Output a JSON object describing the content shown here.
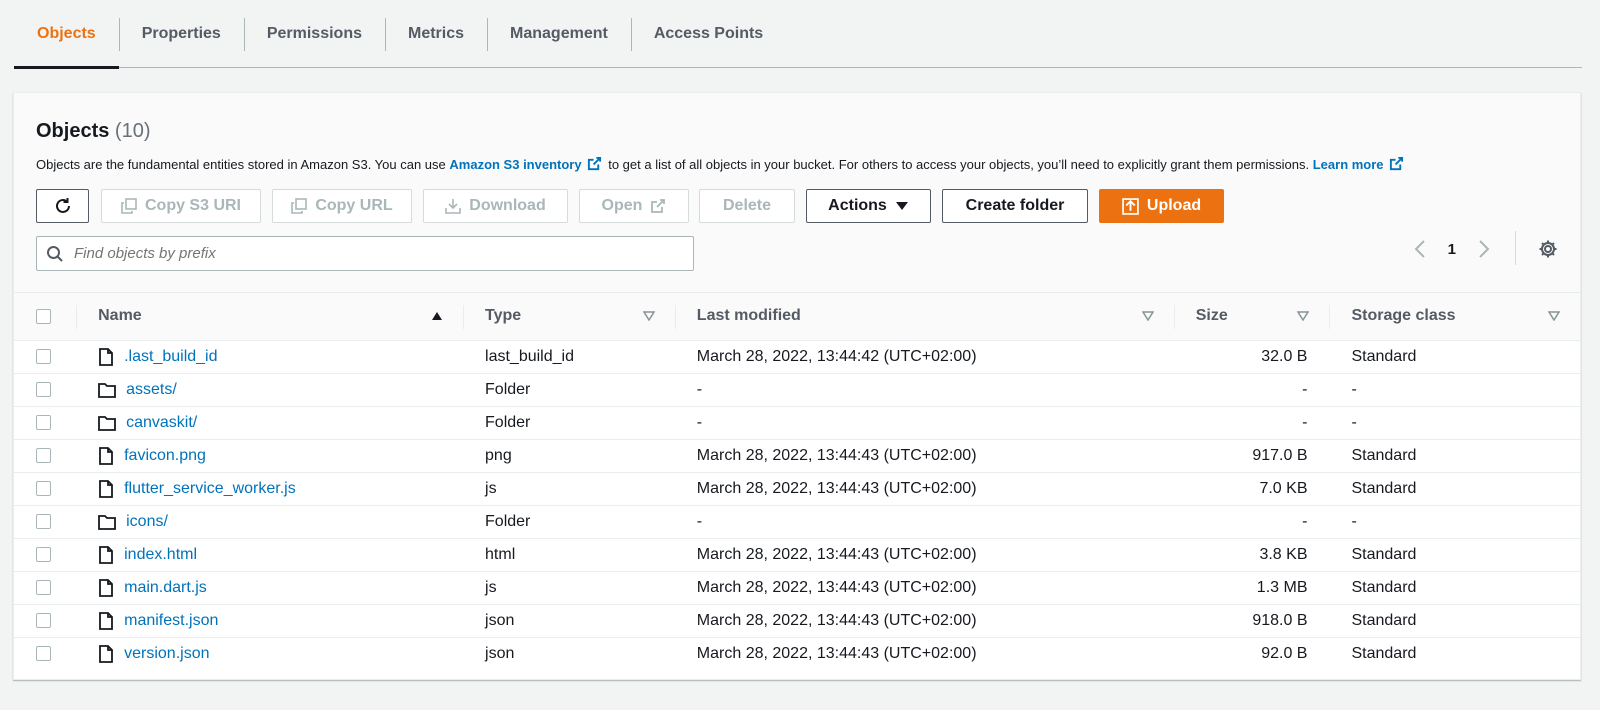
{
  "tabs": [
    {
      "label": "Objects"
    },
    {
      "label": "Properties"
    },
    {
      "label": "Permissions"
    },
    {
      "label": "Metrics"
    },
    {
      "label": "Management"
    },
    {
      "label": "Access Points"
    }
  ],
  "objects": {
    "title": "Objects",
    "count": "(10)",
    "description_prefix": "Objects are the fundamental entities stored in Amazon S3. You can use",
    "inventory_link": "Amazon S3 inventory",
    "description_middle": "to get a list of all objects in your bucket. For others to access your objects, you’ll need to explicitly grant them permissions.",
    "learn_more": "Learn more"
  },
  "toolbar": {
    "copy_s3_uri": "Copy S3 URI",
    "copy_url": "Copy URL",
    "download": "Download",
    "open": "Open",
    "delete": "Delete",
    "actions": "Actions",
    "create_folder": "Create folder",
    "upload": "Upload"
  },
  "search": {
    "placeholder": "Find objects by prefix"
  },
  "pagination": {
    "page": "1"
  },
  "table": {
    "headers": {
      "name": "Name",
      "type": "Type",
      "last_modified": "Last modified",
      "size": "Size",
      "storage_class": "Storage class"
    },
    "rows": [
      {
        "kind": "file",
        "name": ".last_build_id",
        "type": "last_build_id",
        "modified": "March 28, 2022, 13:44:42 (UTC+02:00)",
        "size": "32.0 B",
        "storage": "Standard"
      },
      {
        "kind": "folder",
        "name": "assets/",
        "type": "Folder",
        "modified": "-",
        "size": "-",
        "storage": "-"
      },
      {
        "kind": "folder",
        "name": "canvaskit/",
        "type": "Folder",
        "modified": "-",
        "size": "-",
        "storage": "-"
      },
      {
        "kind": "file",
        "name": "favicon.png",
        "type": "png",
        "modified": "March 28, 2022, 13:44:43 (UTC+02:00)",
        "size": "917.0 B",
        "storage": "Standard"
      },
      {
        "kind": "file",
        "name": "flutter_service_worker.js",
        "type": "js",
        "modified": "March 28, 2022, 13:44:43 (UTC+02:00)",
        "size": "7.0 KB",
        "storage": "Standard"
      },
      {
        "kind": "folder",
        "name": "icons/",
        "type": "Folder",
        "modified": "-",
        "size": "-",
        "storage": "-"
      },
      {
        "kind": "file",
        "name": "index.html",
        "type": "html",
        "modified": "March 28, 2022, 13:44:43 (UTC+02:00)",
        "size": "3.8 KB",
        "storage": "Standard"
      },
      {
        "kind": "file",
        "name": "main.dart.js",
        "type": "js",
        "modified": "March 28, 2022, 13:44:43 (UTC+02:00)",
        "size": "1.3 MB",
        "storage": "Standard"
      },
      {
        "kind": "file",
        "name": "manifest.json",
        "type": "json",
        "modified": "March 28, 2022, 13:44:43 (UTC+02:00)",
        "size": "918.0 B",
        "storage": "Standard"
      },
      {
        "kind": "file",
        "name": "version.json",
        "type": "json",
        "modified": "March 28, 2022, 13:44:43 (UTC+02:00)",
        "size": "92.0 B",
        "storage": "Standard"
      }
    ]
  },
  "colors": {
    "accent": "#ec7211",
    "link": "#0073bb",
    "text": "#16191f",
    "muted": "#545b64"
  }
}
